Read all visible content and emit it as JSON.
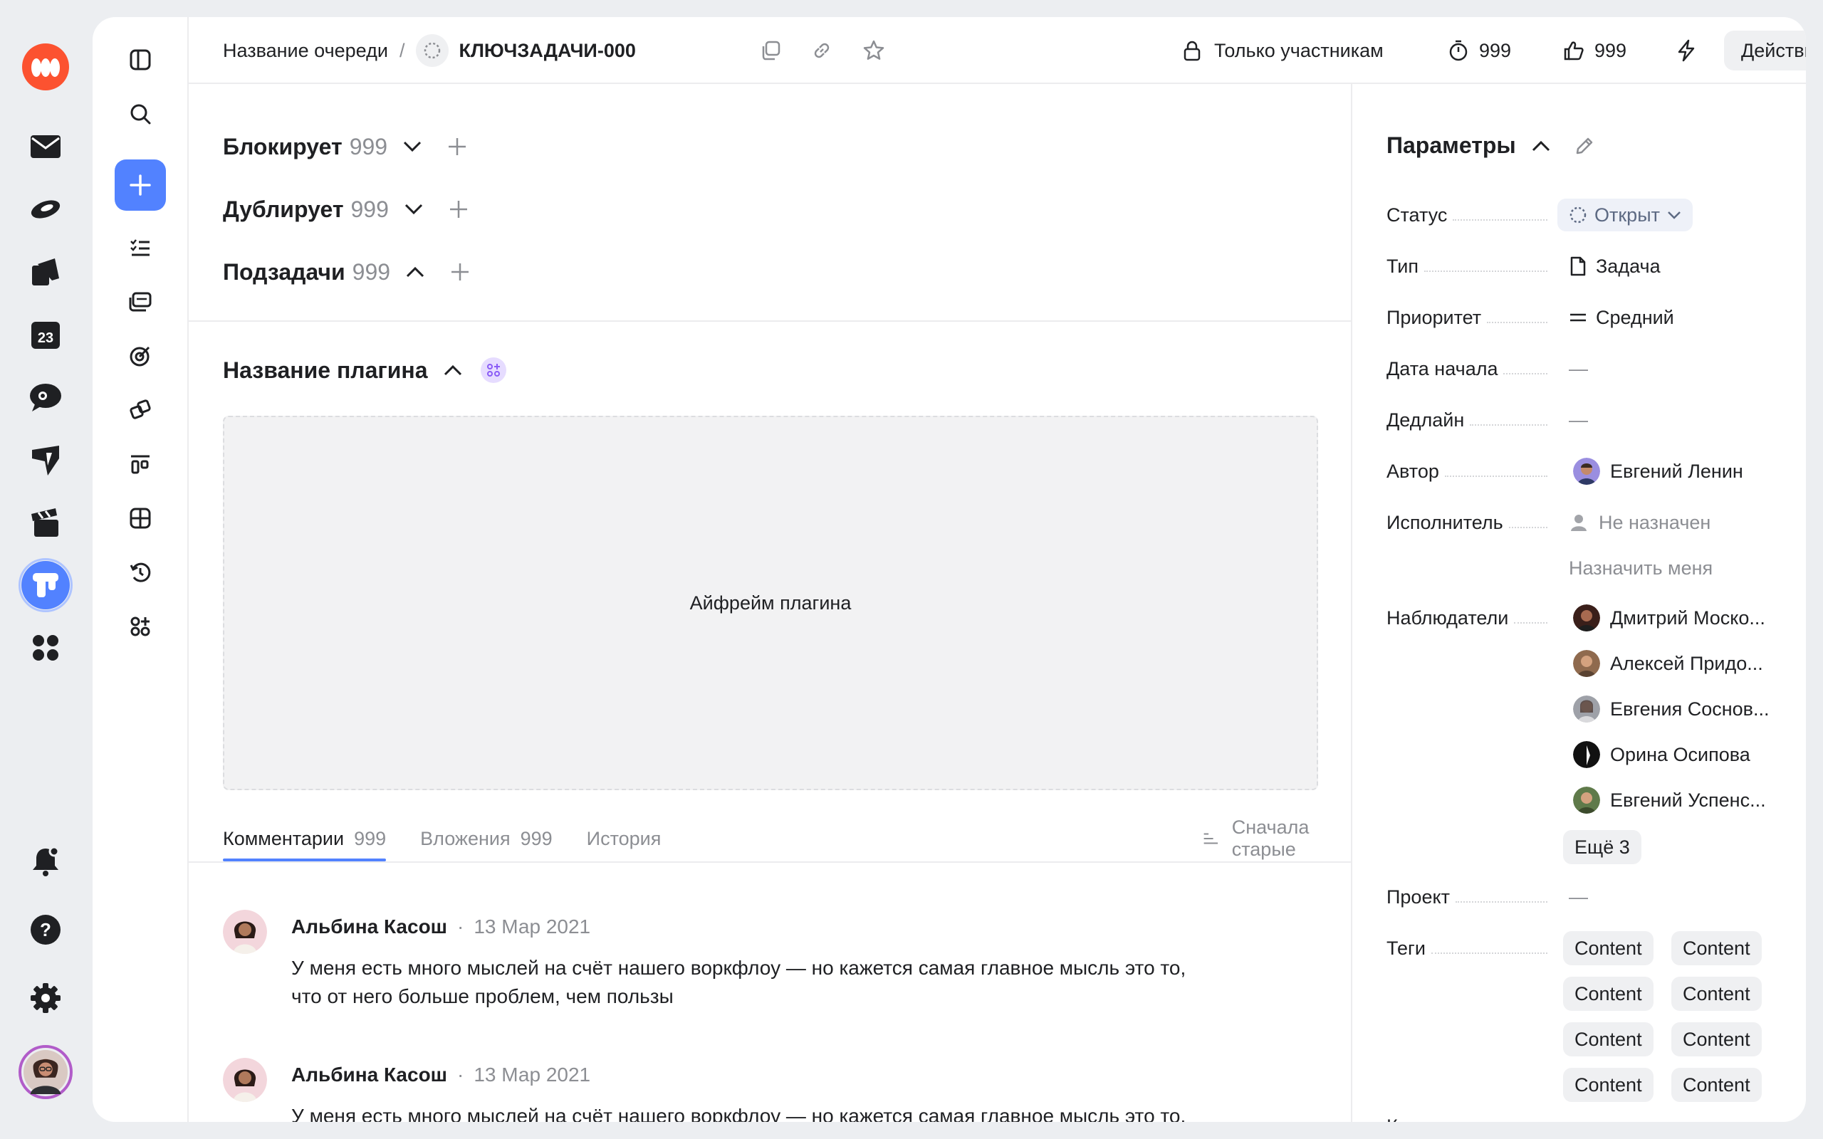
{
  "colors": {
    "accent": "#5282ff",
    "brand_orange": "#fc5230",
    "muted_text": "#8c8e93",
    "plugin_badge": "#e6dcff"
  },
  "rail": {
    "items": [
      "logo-icon",
      "mail-icon",
      "disk-icon",
      "docs-icon",
      "calendar-icon",
      "messenger-icon",
      "forms-icon",
      "clapper-icon",
      "tracker-icon",
      "services-icon"
    ],
    "calendar_day": "23",
    "bottom": [
      "notifications-icon",
      "help-icon",
      "settings-icon",
      "profile-avatar"
    ]
  },
  "secnav": {
    "items": [
      "panel-toggle-icon",
      "search-icon",
      "create-icon",
      "tasks-icon",
      "queues-icon",
      "goals-icon",
      "projects-icon",
      "boards-icon",
      "dashboards-icon",
      "history-icon",
      "plugins-icon"
    ]
  },
  "topbar": {
    "queue_name": "Название очереди",
    "separator": "/",
    "issue_key": "КЛЮЧЗАДАЧИ-000",
    "access": "Только участникам",
    "timer_count": "999",
    "likes_count": "999",
    "actions_label": "Действия"
  },
  "links": [
    {
      "label": "Блокирует",
      "count": "999",
      "expanded": false
    },
    {
      "label": "Дублирует",
      "count": "999",
      "expanded": false
    },
    {
      "label": "Подзадачи",
      "count": "999",
      "expanded": true
    }
  ],
  "plugin": {
    "title": "Название плагина",
    "iframe_label": "Айфрейм плагина"
  },
  "tabs": [
    {
      "label": "Комментарии",
      "count": "999",
      "active": true
    },
    {
      "label": "Вложения",
      "count": "999",
      "active": false
    },
    {
      "label": "История",
      "count": "",
      "active": false
    }
  ],
  "sort_label": "Сначала старые",
  "comments": [
    {
      "author": "Альбина Касош",
      "sep": "·",
      "date": "13 Мар 2021",
      "text_line1": "У меня есть много мыслей на счёт нашего воркфлоу — но кажется самая главное мысль это то,",
      "text_line2": "что от него больше проблем, чем пользы"
    },
    {
      "author": "Альбина Касош",
      "sep": "·",
      "date": "13 Мар 2021",
      "text_line1": "У меня есть много мыслей на счёт нашего воркфлоу — но кажется самая главное мысль это то,",
      "text_line2": ""
    }
  ],
  "params": {
    "title": "Параметры",
    "status_label": "Статус",
    "status_value": "Открыт",
    "type_label": "Тип",
    "type_value": "Задача",
    "priority_label": "Приоритет",
    "priority_value": "Средний",
    "start_label": "Дата начала",
    "start_value": "—",
    "deadline_label": "Дедлайн",
    "deadline_value": "—",
    "author_label": "Автор",
    "author_value": "Евгений Ленин",
    "assignee_label": "Исполнитель",
    "assignee_value": "Не назначен",
    "assign_me": "Назначить меня",
    "watchers_label": "Наблюдатели",
    "watchers": [
      "Дмитрий Моско...",
      "Алексей Придо...",
      "Евгения Соснов...",
      "Орина Осипова",
      "Евгений Успенс..."
    ],
    "more_watchers": "Ещё 3",
    "project_label": "Проект",
    "project_value": "—",
    "tags_label": "Теги",
    "tags": [
      "Content",
      "Content",
      "Content",
      "Content",
      "Content",
      "Content",
      "Content",
      "Content"
    ],
    "component_label": "Компонент"
  }
}
